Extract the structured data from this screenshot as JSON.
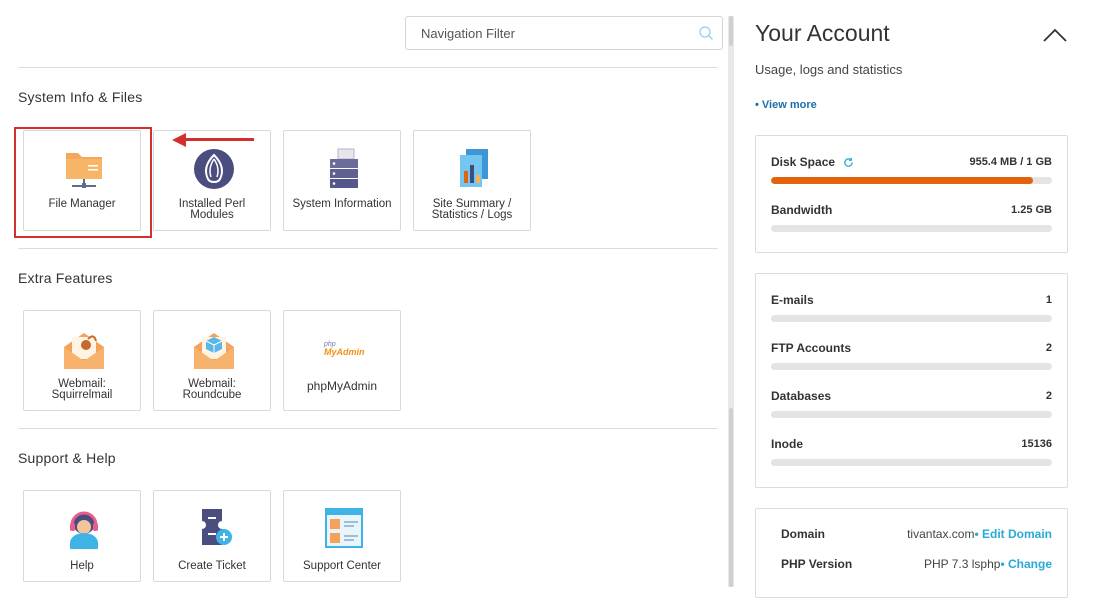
{
  "search": {
    "placeholder": "Navigation Filter"
  },
  "sections": [
    {
      "title": "System Info & Files",
      "tiles": [
        {
          "label": "File Manager",
          "icon": "folder-icon"
        },
        {
          "label": "Installed Perl Modules",
          "icon": "perl-onion-icon"
        },
        {
          "label": "System Information",
          "icon": "server-icon"
        },
        {
          "label": "Site Summary / Statistics / Logs",
          "icon": "stats-report-icon"
        }
      ]
    },
    {
      "title": "Extra Features",
      "tiles": [
        {
          "label": "Webmail: Squirrelmail",
          "icon": "squirrelmail-icon"
        },
        {
          "label": "Webmail: Roundcube",
          "icon": "roundcube-icon"
        },
        {
          "label": "phpMyAdmin",
          "icon": "phpmyadmin-icon"
        }
      ]
    },
    {
      "title": "Support & Help",
      "tiles": [
        {
          "label": "Help",
          "icon": "help-headset-icon"
        },
        {
          "label": "Create Ticket",
          "icon": "create-ticket-icon"
        },
        {
          "label": "Support Center",
          "icon": "support-center-icon"
        }
      ]
    }
  ],
  "logo_text": {
    "php": "php",
    "myadmin": "MyAdmin"
  },
  "account": {
    "title": "Your Account",
    "subtitle": "Usage, logs and statistics",
    "view_more": "• View more",
    "disk": {
      "label": "Disk Space",
      "value": "955.4 MB / 1 GB",
      "percent": 93.3
    },
    "bandwidth": {
      "label": "Bandwidth",
      "value": "1.25 GB",
      "percent": 0
    },
    "stats": [
      {
        "label": "E-mails",
        "value": "1",
        "percent": 0
      },
      {
        "label": "FTP Accounts",
        "value": "2",
        "percent": 0
      },
      {
        "label": "Databases",
        "value": "2",
        "percent": 0
      },
      {
        "label": "Inode",
        "value": "15136",
        "percent": 0
      }
    ],
    "domain": {
      "label": "Domain",
      "value": "tivantax.com",
      "link": "• Edit Domain"
    },
    "php": {
      "label": "PHP Version",
      "value": "PHP 7.3 lsphp",
      "link": "• Change"
    }
  },
  "colors": {
    "accent_red": "#d32f2f",
    "bar_fill": "#e3620c",
    "link_blue": "#29a9d6"
  }
}
